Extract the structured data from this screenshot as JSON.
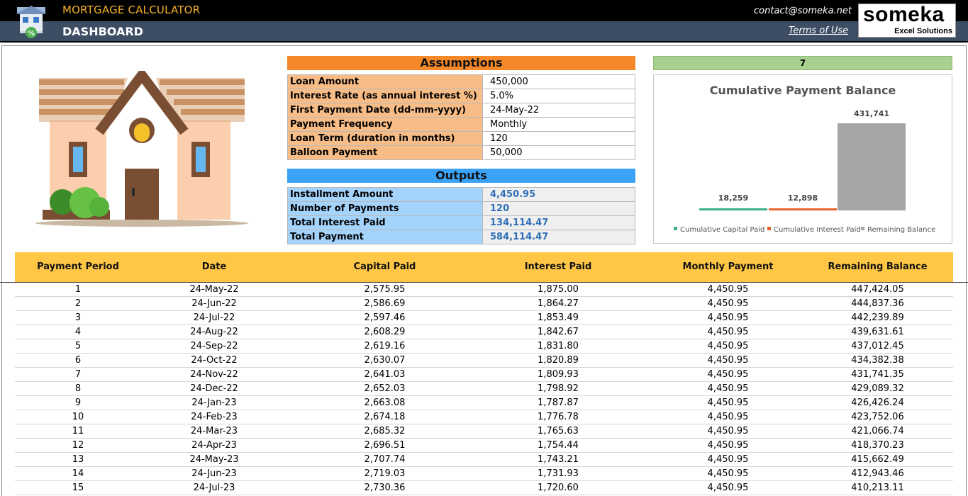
{
  "header": {
    "app_title": "MORTGAGE CALCULATOR",
    "page_title": "DASHBOARD",
    "contact": "contact@someka.net",
    "terms_link": "Terms of Use",
    "brand_name": "someka",
    "brand_tagline": "Excel Solutions"
  },
  "assumptions": {
    "title": "Assumptions",
    "rows": [
      {
        "label": "Loan Amount",
        "value": "450,000"
      },
      {
        "label": "Interest Rate (as annual interest %)",
        "value": "5.0%"
      },
      {
        "label": "First Payment Date (dd-mm-yyyy)",
        "value": "24-May-22"
      },
      {
        "label": "Payment Frequency",
        "value": "Monthly"
      },
      {
        "label": "Loan Term (duration in months)",
        "value": "120"
      },
      {
        "label": "Balloon Payment",
        "value": "50,000"
      }
    ]
  },
  "outputs": {
    "title": "Outputs",
    "rows": [
      {
        "label": "Installment Amount",
        "value": "4,450.95"
      },
      {
        "label": "Number of Payments",
        "value": "120"
      },
      {
        "label": "Total Interest Paid",
        "value": "134,114.47"
      },
      {
        "label": "Total Payment",
        "value": "584,114.47"
      }
    ]
  },
  "period_selector": {
    "value": "7"
  },
  "colors": {
    "capital": "#3fae8c",
    "interest": "#e8642c",
    "remaining": "#a5a5a5"
  },
  "chart_data": {
    "type": "bar",
    "title": "Cumulative Payment Balance",
    "categories": [
      "Cumulative Capital Paid",
      "Cumulative Interest Paid",
      "Remaining Balance"
    ],
    "values": [
      18259,
      12898,
      431741
    ],
    "data_labels": [
      "18,259",
      "12,898",
      "431,741"
    ],
    "legend": [
      "Cumulative Capital Paid",
      "Cumulative Interest Paid",
      "Remaining Balance"
    ],
    "legend_position": "bottom",
    "grid": false
  },
  "table": {
    "columns": [
      "Payment Period",
      "Date",
      "Capital Paid",
      "Interest Paid",
      "Monthly Payment",
      "Remaining Balance"
    ],
    "rows": [
      [
        "1",
        "24-May-22",
        "2,575.95",
        "1,875.00",
        "4,450.95",
        "447,424.05"
      ],
      [
        "2",
        "24-Jun-22",
        "2,586.69",
        "1,864.27",
        "4,450.95",
        "444,837.36"
      ],
      [
        "3",
        "24-Jul-22",
        "2,597.46",
        "1,853.49",
        "4,450.95",
        "442,239.89"
      ],
      [
        "4",
        "24-Aug-22",
        "2,608.29",
        "1,842.67",
        "4,450.95",
        "439,631.61"
      ],
      [
        "5",
        "24-Sep-22",
        "2,619.16",
        "1,831.80",
        "4,450.95",
        "437,012.45"
      ],
      [
        "6",
        "24-Oct-22",
        "2,630.07",
        "1,820.89",
        "4,450.95",
        "434,382.38"
      ],
      [
        "7",
        "24-Nov-22",
        "2,641.03",
        "1,809.93",
        "4,450.95",
        "431,741.35"
      ],
      [
        "8",
        "24-Dec-22",
        "2,652.03",
        "1,798.92",
        "4,450.95",
        "429,089.32"
      ],
      [
        "9",
        "24-Jan-23",
        "2,663.08",
        "1,787.87",
        "4,450.95",
        "426,426.24"
      ],
      [
        "10",
        "24-Feb-23",
        "2,674.18",
        "1,776.78",
        "4,450.95",
        "423,752.06"
      ],
      [
        "11",
        "24-Mar-23",
        "2,685.32",
        "1,765.63",
        "4,450.95",
        "421,066.74"
      ],
      [
        "12",
        "24-Apr-23",
        "2,696.51",
        "1,754.44",
        "4,450.95",
        "418,370.23"
      ],
      [
        "13",
        "24-May-23",
        "2,707.74",
        "1,743.21",
        "4,450.95",
        "415,662.49"
      ],
      [
        "14",
        "24-Jun-23",
        "2,719.03",
        "1,731.93",
        "4,450.95",
        "412,943.46"
      ],
      [
        "15",
        "24-Jul-23",
        "2,730.36",
        "1,720.60",
        "4,450.95",
        "410,213.11"
      ]
    ]
  }
}
